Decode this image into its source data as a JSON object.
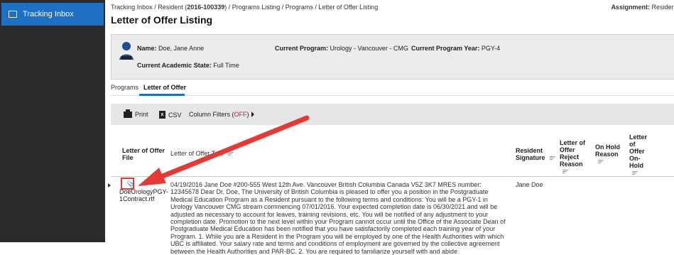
{
  "sidebar": {
    "active_label": "Tracking Inbox"
  },
  "header": {
    "breadcrumb_pre": "Tracking Inbox / Resident (",
    "breadcrumb_id": "2016-100339",
    "breadcrumb_post": ") / Programs Listing / Programs / Letter of Offer Listing",
    "title": "Letter of Offer Listing",
    "assignment_label": "Assignment:",
    "assignment_value": "Resident"
  },
  "resident": {
    "name_label": "Name:",
    "name_value": "Doe, Jane Anne",
    "program_label": "Current Program:",
    "program_value": "Urology - Vancouver - CMG",
    "year_label": "Current Program Year:",
    "year_value": "PGY-4",
    "state_label": "Current Academic State:",
    "state_value": "Full Time"
  },
  "tabs": [
    {
      "label": "Programs",
      "active": false
    },
    {
      "label": "Letter of Offer",
      "active": true
    }
  ],
  "toolbar": {
    "print_label": "Print",
    "csv_label": "CSV",
    "filters_label": "Column Filters (",
    "filters_state": "OFF",
    "filters_close": ")"
  },
  "table": {
    "columns": {
      "file": "Letter of Offer File",
      "text": "Letter of Offer Text",
      "signature": "Resident Signature",
      "reject": "Letter of Offer Reject Reason",
      "hold": "On Hold Reason",
      "onhold": "Letter of Offer On-Hold"
    },
    "rows": [
      {
        "file": "DoeUrologyPGY-1Contract.rtf",
        "text": "04/19/2016 Jane Doe #200-555 West 12th Ave. Vancouver British Columbia Canada V5Z 3K7 MRES number: 12345678 Dear Dr. Doe, The University of British Columbia is pleased to offer you a position in the Postgraduate Medical Education Program as a Resident pursuant to the following terms and conditions: You will be a PGY-1 in Urology Vancouver CMG stream commencing 07/01/2016. Your expected completion date is 06/30/2021 and will be adjusted as necessary to account for leaves, training revisions, etc. You will be notified of any adjustment to your completion date. Promotion to the next level within your Program cannot occur until the Office of the Associate Dean of Postgraduate Medical Education has been notified that you have satisfactorily completed each training year of your Program. 1. While you are a Resident in the Program you will be employed by one of the Health Authorities with which UBC is affiliated. Your salary rate and terms and conditions of employment are governed by the collective agreement between the Health Authorities and PAR-BC. 2. You are required to familiarize yourself with and abide",
        "signature": "Jane Doe"
      }
    ]
  },
  "colors": {
    "accent": "#1f6fc5",
    "annotation": "#e53935"
  }
}
